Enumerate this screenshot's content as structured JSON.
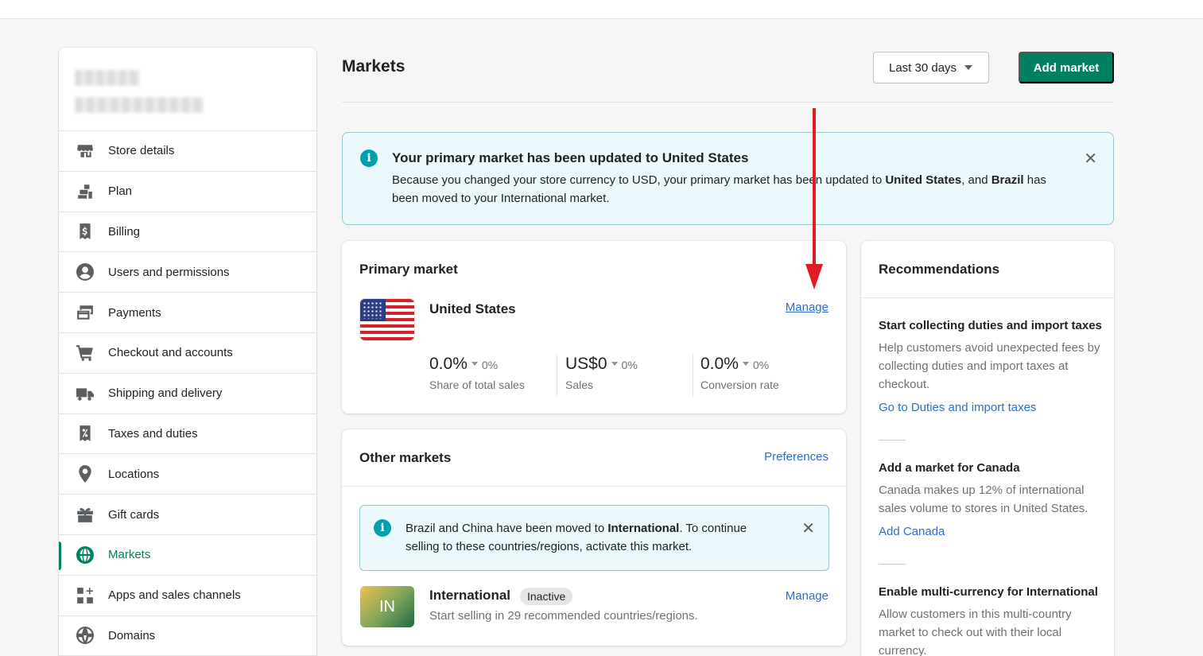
{
  "sidebar": {
    "items": [
      {
        "label": "Store details",
        "icon": "store-icon"
      },
      {
        "label": "Plan",
        "icon": "plan-icon"
      },
      {
        "label": "Billing",
        "icon": "billing-icon"
      },
      {
        "label": "Users and permissions",
        "icon": "user-icon"
      },
      {
        "label": "Payments",
        "icon": "payments-icon"
      },
      {
        "label": "Checkout and accounts",
        "icon": "cart-icon"
      },
      {
        "label": "Shipping and delivery",
        "icon": "truck-icon"
      },
      {
        "label": "Taxes and duties",
        "icon": "tax-icon"
      },
      {
        "label": "Locations",
        "icon": "location-pin-icon"
      },
      {
        "label": "Gift cards",
        "icon": "gift-icon"
      },
      {
        "label": "Markets",
        "icon": "globe-icon",
        "active": true
      },
      {
        "label": "Apps and sales channels",
        "icon": "apps-icon"
      },
      {
        "label": "Domains",
        "icon": "domain-globe-icon"
      }
    ]
  },
  "header": {
    "title": "Markets",
    "date_range": "Last 30 days",
    "add_market": "Add market"
  },
  "banner": {
    "title": "Your primary market has been updated to United States",
    "text_1": "Because you changed your store currency to USD, your primary market has been updated to ",
    "bold_1": "United States",
    "text_2": ", and ",
    "bold_2": "Brazil",
    "text_3": " has been moved to your International market."
  },
  "primary_market": {
    "title": "Primary market",
    "country": "United States",
    "manage": "Manage",
    "metrics": [
      {
        "value": "0.0%",
        "change": "0%",
        "label": "Share of total sales"
      },
      {
        "value": "US$0",
        "change": "0%",
        "label": "Sales"
      },
      {
        "value": "0.0%",
        "change": "0%",
        "label": "Conversion rate"
      }
    ]
  },
  "other_markets": {
    "title": "Other markets",
    "preferences": "Preferences",
    "notice_1": "Brazil and China have been moved to ",
    "notice_bold": "International",
    "notice_2": ". To continue selling to these countries/regions, activate this market.",
    "market": {
      "badge": "IN",
      "name": "International",
      "status": "Inactive",
      "subtitle": "Start selling in 29 recommended countries/regions.",
      "manage": "Manage"
    }
  },
  "recommendations": {
    "title": "Recommendations",
    "items": [
      {
        "title": "Start collecting duties and import taxes",
        "text": "Help customers avoid unexpected fees by collecting duties and import taxes at checkout.",
        "link": "Go to Duties and import taxes"
      },
      {
        "title": "Add a market for Canada",
        "text": "Canada makes up 12% of international sales volume to stores in United States.",
        "link": "Add Canada"
      },
      {
        "title": "Enable multi-currency for International",
        "text": "Allow customers in this multi-country market to check out with their local currency.",
        "link": ""
      }
    ]
  },
  "colors": {
    "accent": "#008060",
    "link": "#2c6ecb",
    "info": "#00a0ac",
    "annotation_arrow": "#e01b24"
  }
}
